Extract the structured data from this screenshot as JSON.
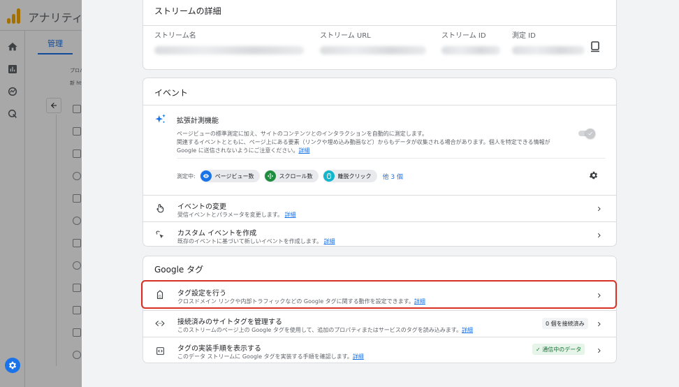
{
  "app": {
    "title": "アナリティ",
    "admin_tab": "管理",
    "property_label": "プロパ",
    "property_value": "新 htt"
  },
  "stream_details": {
    "title": "ストリームの詳細",
    "columns": [
      {
        "label": "ストリーム名"
      },
      {
        "label": "ストリーム URL"
      },
      {
        "label": "ストリーム ID"
      },
      {
        "label": "測定 ID"
      }
    ]
  },
  "events": {
    "title": "イベント",
    "enhanced": {
      "title": "拡張計測機能",
      "desc_1": "ページビューの標準測定に加え、サイトのコンテンツとのインタラクションを自動的に測定します。",
      "desc_2": "関連するイベントとともに、ページ上にある要素（リンクや埋め込み動画など）からもデータが収集される場合があります。個人を特定できる情報が",
      "desc_3": "Google に送信されないようにご注意ください。",
      "details_link": "詳細",
      "toggle_on": true,
      "measuring_label": "測定中:",
      "chips": [
        {
          "label": "ページビュー数",
          "icon": "eye-icon",
          "color": "#1a73e8"
        },
        {
          "label": "スクロール数",
          "icon": "scroll-icon",
          "color": "#1e8e3e"
        },
        {
          "label": "離脱クリック",
          "icon": "mouse-icon",
          "color": "#12b5cb"
        }
      ],
      "more": "他 3 個"
    },
    "rows": [
      {
        "title": "イベントの変更",
        "desc": "受信イベントとパラメータを変更します。",
        "link": "詳細",
        "icon": "touch-icon"
      },
      {
        "title": "カスタム イベントを作成",
        "desc": "既存のイベントに基づいて新しいイベントを作成します。",
        "link": "詳細",
        "icon": "sparkle-click-icon"
      }
    ]
  },
  "google_tag": {
    "title": "Google タグ",
    "rows": [
      {
        "title": "タグ設定を行う",
        "desc": "クロスドメイン リンクや内部トラフィックなどの Google タグに関する動作を設定できます。",
        "link": "詳細",
        "icon": "tag-icon"
      },
      {
        "title": "接続済みのサイトタグを管理する",
        "desc": "このストリームのページ上の Google タグを使用して、追加のプロパティまたはサービスのタグを読み込みます。",
        "link": "詳細",
        "icon": "code-icon",
        "status": "0 個を接続済み"
      },
      {
        "title": "タグの実装手順を表示する",
        "desc": "このデータ ストリームに Google タグを実装する手順を確認します。",
        "link": "詳細",
        "icon": "code-box-icon",
        "status": "✓ 通信中のデータ"
      }
    ]
  },
  "colors": {
    "accent": "#1a73e8",
    "highlight": "#d93025",
    "success": "#137333"
  }
}
